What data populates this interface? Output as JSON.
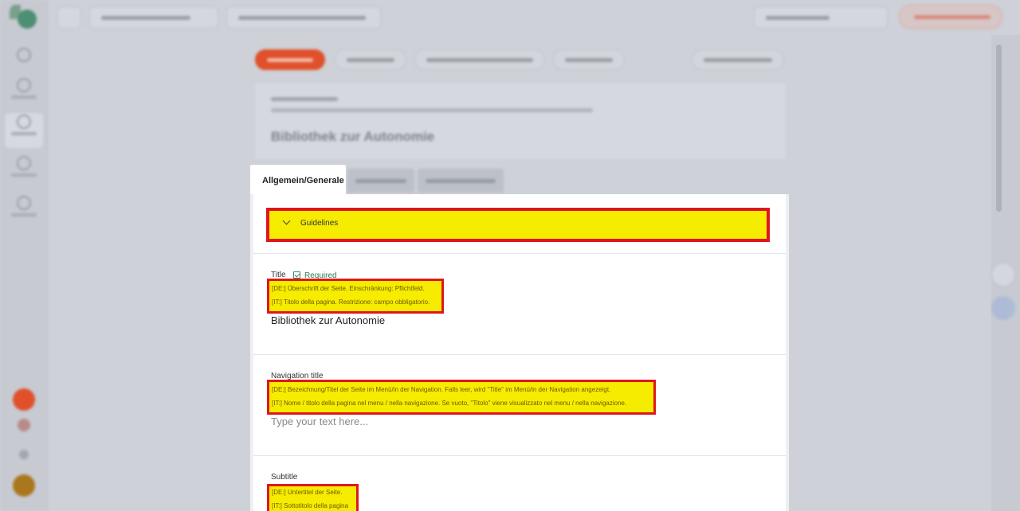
{
  "colors": {
    "highlight": "#f6ec00",
    "highlight_border": "#e0161d",
    "required": "#2f7a55",
    "primary": "#e0502a"
  },
  "sidebar": {
    "icons": [
      "logo-icon",
      "dashboard-icon",
      "globe-icon",
      "pages-icon",
      "users-icon",
      "settings-icon"
    ]
  },
  "tabs": {
    "active_label": "Allgemein/Generale"
  },
  "guidelines": {
    "label": "Guidelines",
    "icon": "chevron-down-icon"
  },
  "fields": [
    {
      "label": "Title",
      "required_label": "Required",
      "hint_de": "[DE:] Überschrift der Seite. Einschränkung: Pflichtfeld.",
      "hint_it": "[IT:] Titolo della pagina. Restrizione: campo obbligatorio.",
      "value": "Bibliothek zur Autonomie"
    },
    {
      "label": "Navigation title",
      "hint_de": "[DE:] Bezeichnung/Titel der Seite im Menü/in der Navigation. Falls leer, wird \"Title\" im Menü/in der Navigation angezeigt.",
      "hint_it": "[IT:] Nome / titolo della pagina nel menu / nella navigazione. Se vuoto, \"Titolo\" viene visualizzato nel menu / nella navigazione.",
      "placeholder": "Type your text here..."
    },
    {
      "label": "Subtitle",
      "hint_de": "[DE:] Untertitel der Seite.",
      "hint_it": "[IT:] Sottotitolo della pagina"
    }
  ]
}
